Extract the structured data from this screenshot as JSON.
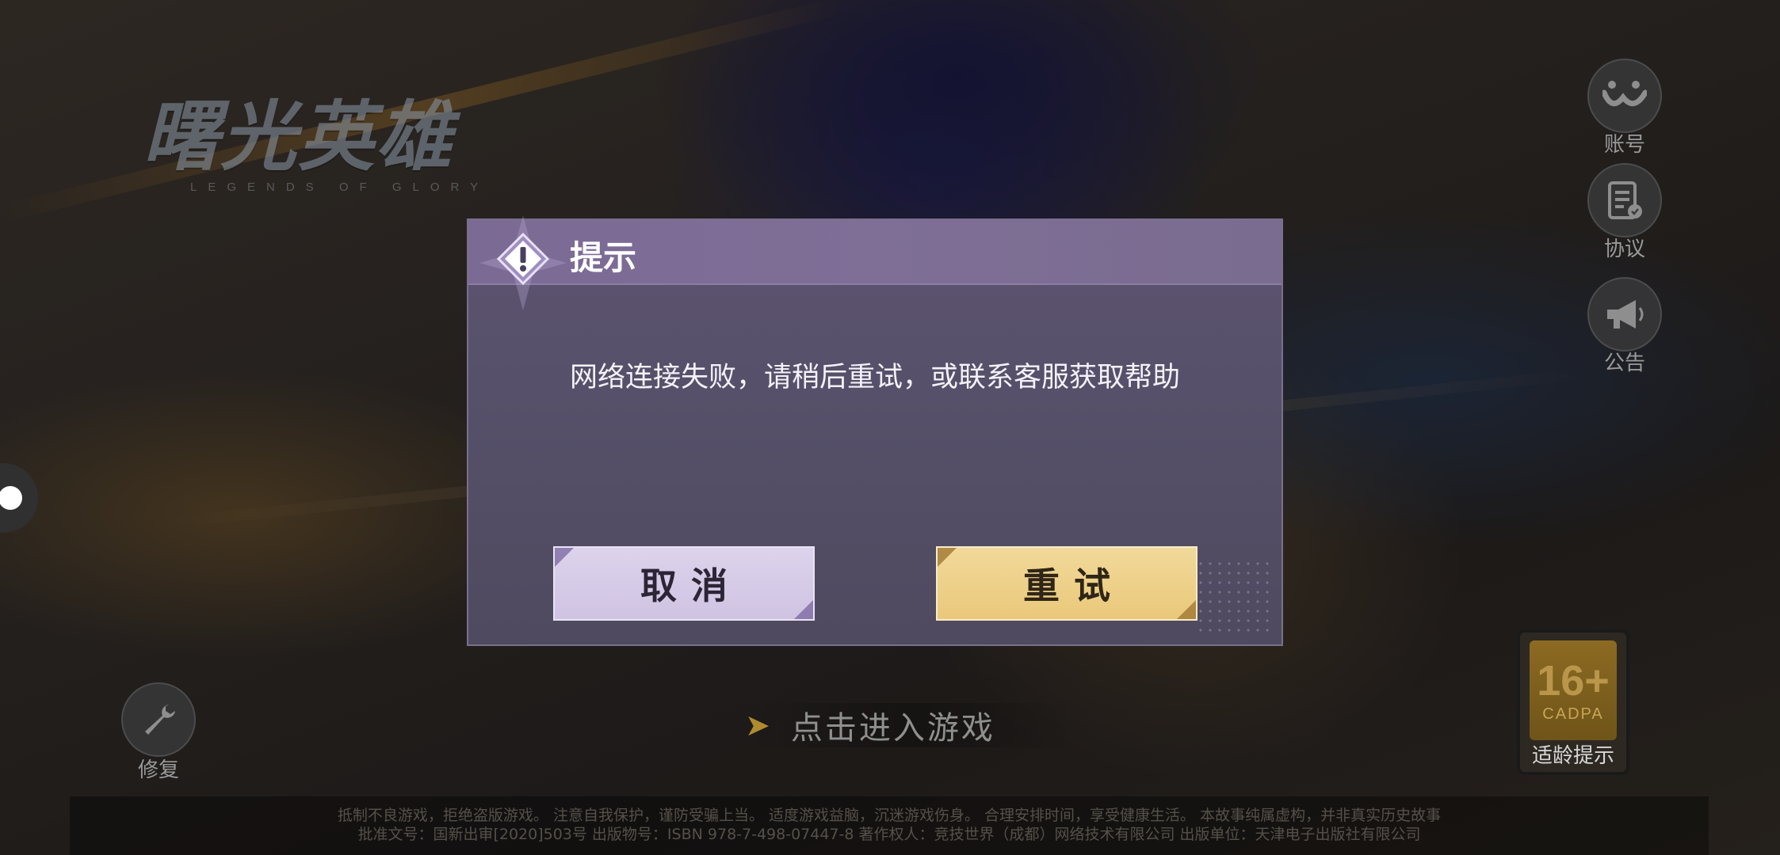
{
  "logo": {
    "title": "曙光英雄",
    "subtitle": "LEGENDS OF GLORY"
  },
  "side_menu": {
    "account": {
      "label": "账号",
      "icon": "account-icon"
    },
    "agreement": {
      "label": "协议",
      "icon": "agreement-icon"
    },
    "announcement": {
      "label": "公告",
      "icon": "megaphone-icon"
    }
  },
  "repair": {
    "label": "修复",
    "icon": "wrench-icon"
  },
  "enter_game": {
    "label": "点击进入游戏",
    "icon": "chevron-right-icon"
  },
  "age_rating": {
    "number": "16+",
    "org": "CADPA",
    "label": "适龄提示"
  },
  "legal": {
    "line1": "抵制不良游戏，拒绝盗版游戏。  注意自我保护，谨防受骗上当。  适度游戏益脑，沉迷游戏伤身。  合理安排时间，享受健康生活。 本故事纯属虚构，并非真实历史故事",
    "line2": "批准文号：国新出审[2020]503号  出版物号：ISBN 978-7-498-07447-8  著作权人：竞技世界（成都）网络技术有限公司  出版单位：天津电子出版社有限公司"
  },
  "dialog": {
    "title": "提示",
    "message": "网络连接失败，请稍后重试，或联系客服获取帮助",
    "cancel_label": "取消",
    "retry_label": "重试"
  },
  "colors": {
    "dialog_bg": "#56506a",
    "dialog_header": "#7b6a94",
    "cancel_button": "#d9cfe9",
    "retry_button": "#eed28f"
  }
}
